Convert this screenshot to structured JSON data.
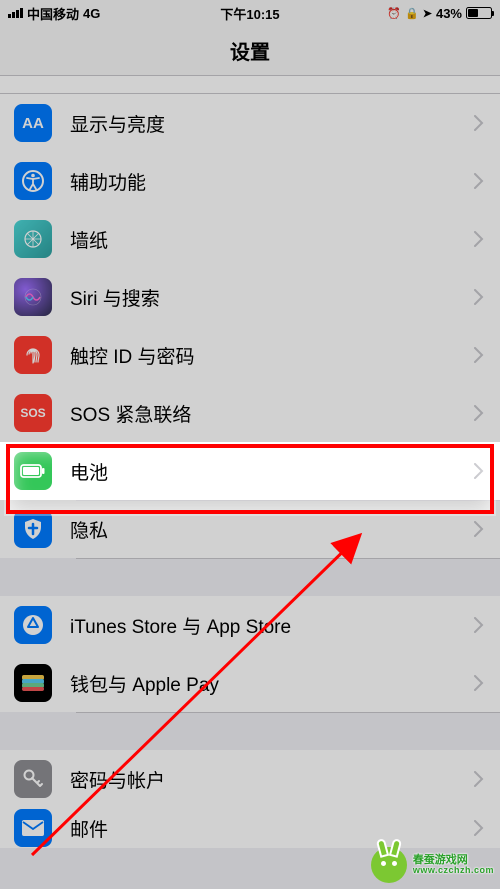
{
  "statusbar": {
    "carrier": "中国移动",
    "network": "4G",
    "time": "下午10:15",
    "alarm_glyph": "⏰",
    "lock_glyph": "🔒",
    "location_glyph": "➤",
    "battery_pct": "43%"
  },
  "nav": {
    "title": "设置"
  },
  "rows": {
    "display": {
      "label": "显示与亮度",
      "icon_text": "AA"
    },
    "accessibility": {
      "label": "辅助功能"
    },
    "wallpaper": {
      "label": "墙纸"
    },
    "siri": {
      "label": "Siri 与搜索"
    },
    "touchid": {
      "label": "触控 ID 与密码"
    },
    "sos": {
      "label": "SOS 紧急联络",
      "icon_text": "SOS"
    },
    "battery": {
      "label": "电池"
    },
    "privacy": {
      "label": "隐私"
    },
    "itunes": {
      "label": "iTunes Store 与 App Store"
    },
    "wallet": {
      "label": "钱包与 Apple Pay"
    },
    "passwords": {
      "label": "密码与帐户"
    },
    "mail": {
      "label": "邮件"
    }
  },
  "annotation": {
    "highlight_row": "battery"
  },
  "watermark": {
    "line1": "春蚕游戏网",
    "line2": "www.czchzh.com"
  }
}
